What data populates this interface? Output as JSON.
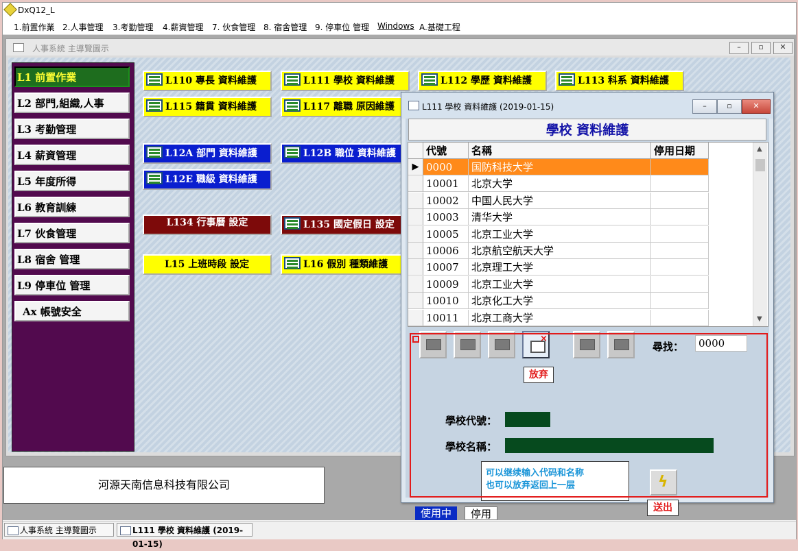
{
  "app": {
    "title": "DxQ12_L"
  },
  "menu": [
    "1.前置作業",
    "2.人事管理",
    "3.考勤管理",
    "4.薪資管理",
    "7. 伙食管理",
    "8. 宿舍管理",
    "9. 停車位 管理",
    "Windows",
    "A.基礎工程"
  ],
  "main_window": {
    "title": "人事系統  主導覽圖示"
  },
  "window_buttons": {
    "minimize": "–",
    "restore": "▫",
    "close": "✕"
  },
  "sidebar": [
    "L1  前置作業",
    "L2  部門,組織,人事",
    "L3  考勤管理",
    "L4  薪資管理",
    "L5  年度所得",
    "L6  教育訓練",
    "L7  伙食管理",
    "L8  宿舍  管理",
    "L9  停車位  管理",
    "Ax  帳號安全"
  ],
  "modules": {
    "l110": "L110  專長  資料維護",
    "l111": "L111  學校  資料維護",
    "l112": "L112  學歷  資料維護",
    "l113": "L113  科系  資料維護",
    "l115": "L115  籍貫  資料維護",
    "l117": "L117  離職  原因維護",
    "l12a": "L12A  部門  資料維護",
    "l12b": "L12B  職位  資料維護",
    "l12e": "L12E  職級  資料維護",
    "l134": "L134  行事曆  設定",
    "l135": "L135  國定假日  設定",
    "l15": "L15  上班時段  設定",
    "l16": "L16  假別  種類維護"
  },
  "company": "河源天南信息科技有限公司",
  "taskbar": [
    "人事系統  主導覽圖示",
    "L111 學校 資料維護 (2019-01-15)"
  ],
  "dialog": {
    "title": "L111 學校 資料維護 (2019-01-15)",
    "heading": "學校  資料維護",
    "columns": [
      "代號",
      "名稱",
      "停用日期"
    ],
    "rows": [
      {
        "code": "0000",
        "name": "国防科技大学",
        "date": "",
        "indicator": "▶"
      },
      {
        "code": "10001",
        "name": "北京大学",
        "date": "",
        "indicator": ""
      },
      {
        "code": "10002",
        "name": "中国人民大学",
        "date": "",
        "indicator": ""
      },
      {
        "code": "10003",
        "name": "清华大学",
        "date": "",
        "indicator": ""
      },
      {
        "code": "10005",
        "name": "北京工业大学",
        "date": "",
        "indicator": ""
      },
      {
        "code": "10006",
        "name": "北京航空航天大学",
        "date": "",
        "indicator": ""
      },
      {
        "code": "10007",
        "name": "北京理工大学",
        "date": "",
        "indicator": ""
      },
      {
        "code": "10009",
        "name": "北京工业大学",
        "date": "",
        "indicator": ""
      },
      {
        "code": "10010",
        "name": "北京化工大学",
        "date": "",
        "indicator": ""
      },
      {
        "code": "10011",
        "name": "北京工商大学",
        "date": "",
        "indicator": ""
      }
    ],
    "search_label": "尋找：",
    "search_value": "0000",
    "abandon_label": "放弃",
    "school_code_label": "學校代號：",
    "school_name_label": "學校名稱：",
    "note_line1": "可以继续输入代码和名称",
    "note_line2": "也可以放弃返回上一层",
    "send_label": "送出",
    "tabs": [
      "使用中",
      "停用"
    ]
  },
  "colors": {
    "selected_row": "#ff8a1a",
    "annotation": "#e21a1a",
    "sidebar_bg": "#520a4e"
  }
}
